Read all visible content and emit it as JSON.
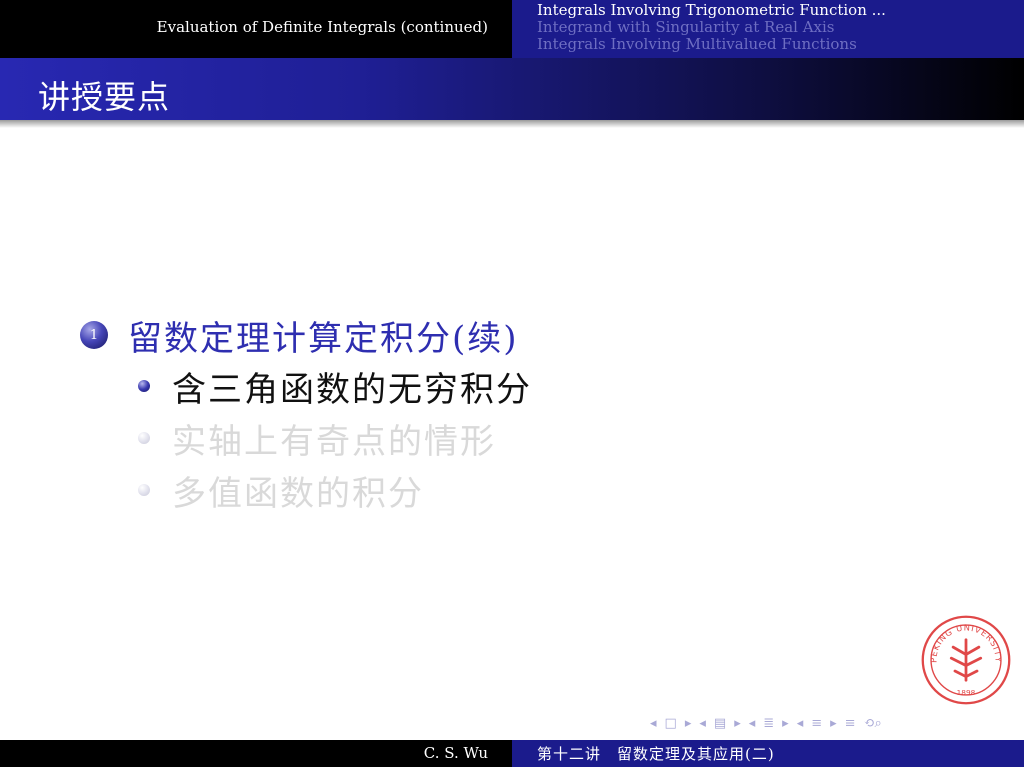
{
  "header": {
    "section_title": "Evaluation of Definite Integrals (continued)",
    "subsections": [
      "Integrals Involving Trigonometric Function ...",
      "Integrand with Singularity at Real Axis",
      "Integrals Involving Multivalued Functions"
    ]
  },
  "frame": {
    "title": "讲授要点"
  },
  "content": {
    "enum_number": "1",
    "item_label": "留数定理计算定积分(续)",
    "sub_items": [
      "含三角函数的无穷积分",
      "实轴上有奇点的情形",
      "多值函数的积分"
    ]
  },
  "seal": {
    "text": "PEKING UNIVERSITY",
    "year": "1898",
    "color": "#e04848"
  },
  "navigation": {
    "icons": [
      "nav-frame-prev-icon",
      "nav-frame-next-icon",
      "nav-subsection-prev-icon",
      "nav-subsection-next-icon",
      "nav-section-prev-icon",
      "nav-section-next-icon",
      "nav-outline-icon",
      "nav-search-icon"
    ]
  },
  "footer": {
    "author": "C. S. Wu",
    "lecture_title": "第十二讲　留数定理及其应用(二)"
  },
  "colors": {
    "accent": "#1b1b8c",
    "item": "#2e2eb0",
    "dim_text": "#d9d9d9"
  }
}
